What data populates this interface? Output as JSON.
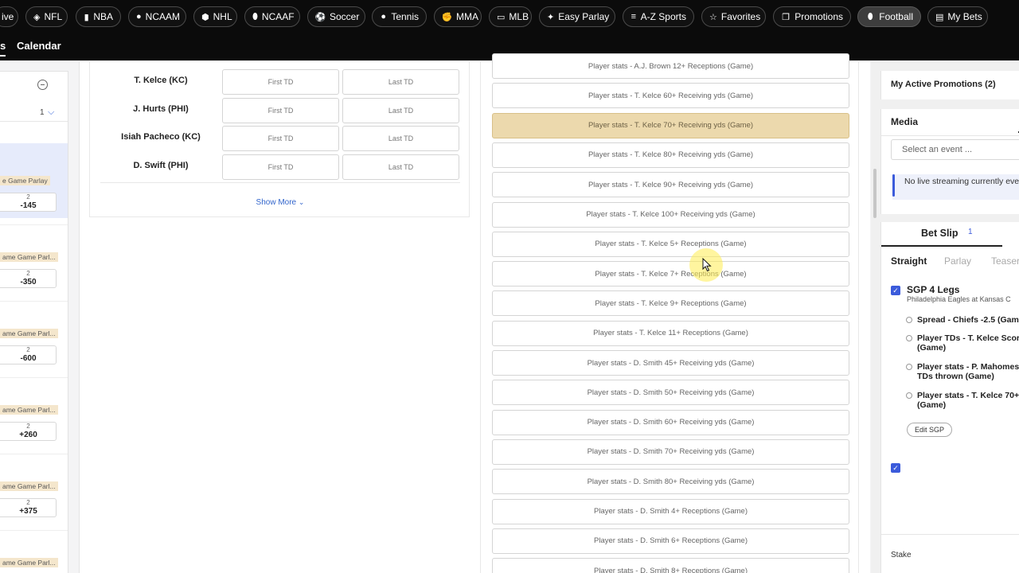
{
  "nav": {
    "pills": [
      {
        "label": "ive",
        "icon": "",
        "active": false
      },
      {
        "label": "NFL",
        "icon": "nfl-icon",
        "active": false
      },
      {
        "label": "NBA",
        "icon": "nba-icon",
        "active": false
      },
      {
        "label": "NCAAM",
        "icon": "basketball-icon",
        "active": false
      },
      {
        "label": "NHL",
        "icon": "nhl-icon",
        "active": false
      },
      {
        "label": "NCAAF",
        "icon": "football-icon",
        "active": false
      },
      {
        "label": "Soccer",
        "icon": "soccer-ball-icon",
        "active": false
      },
      {
        "label": "Tennis",
        "icon": "tennis-ball-icon",
        "active": false
      },
      {
        "label": "MMA",
        "icon": "glove-icon",
        "active": false
      },
      {
        "label": "MLB",
        "icon": "mlb-icon",
        "active": false
      },
      {
        "label": "Easy Parlay",
        "icon": "parlay-icon",
        "active": false
      },
      {
        "label": "A-Z Sports",
        "icon": "menu-icon",
        "active": false
      },
      {
        "label": "Favorites",
        "icon": "star-circle-icon",
        "active": false
      },
      {
        "label": "Promotions",
        "icon": "gift-icon",
        "active": false
      },
      {
        "label": "Football",
        "icon": "football-icon",
        "active": true
      },
      {
        "label": "My Bets",
        "icon": "ticket-icon",
        "active": false
      }
    ],
    "subnav": {
      "partial": "s",
      "calendar": "Calendar"
    }
  },
  "left": {
    "count": "1",
    "entries": [
      {
        "tag": "e Game Parlay",
        "top_label": "2",
        "odds": "-145"
      },
      {
        "tag": "ame Game Parl...",
        "top_label": "2",
        "odds": "-350"
      },
      {
        "tag": "ame Game Parl...",
        "top_label": "2",
        "odds": "-600"
      },
      {
        "tag": "ame Game Parl...",
        "top_label": "2",
        "odds": "+260"
      },
      {
        "tag": "ame Game Parl...",
        "top_label": "2",
        "odds": "+375"
      },
      {
        "tag": "ame Game Parl...",
        "top_label": "",
        "odds": ""
      }
    ]
  },
  "td": {
    "rows": [
      {
        "player": "T. Kelce (KC)",
        "first": "First TD",
        "last": "Last TD"
      },
      {
        "player": "J. Hurts (PHI)",
        "first": "First TD",
        "last": "Last TD"
      },
      {
        "player": "Isiah Pacheco (KC)",
        "first": "First TD",
        "last": "Last TD"
      },
      {
        "player": "D. Swift (PHI)",
        "first": "First TD",
        "last": "Last TD"
      }
    ],
    "show_more": "Show More"
  },
  "player_stats": [
    {
      "label": "Player stats - A.J. Brown 12+ Receptions (Game)",
      "selected": false
    },
    {
      "label": "Player stats - T. Kelce 60+ Receiving yds (Game)",
      "selected": false
    },
    {
      "label": "Player stats - T. Kelce 70+ Receiving yds (Game)",
      "selected": true
    },
    {
      "label": "Player stats - T. Kelce 80+ Receiving yds (Game)",
      "selected": false
    },
    {
      "label": "Player stats - T. Kelce 90+ Receiving yds (Game)",
      "selected": false
    },
    {
      "label": "Player stats - T. Kelce 100+ Receiving yds (Game)",
      "selected": false
    },
    {
      "label": "Player stats - T. Kelce 5+ Receptions (Game)",
      "selected": false
    },
    {
      "label": "Player stats - T. Kelce 7+ Receptions (Game)",
      "selected": false
    },
    {
      "label": "Player stats - T. Kelce 9+ Receptions (Game)",
      "selected": false
    },
    {
      "label": "Player stats - T. Kelce 11+ Receptions (Game)",
      "selected": false
    },
    {
      "label": "Player stats - D. Smith 45+ Receiving yds (Game)",
      "selected": false
    },
    {
      "label": "Player stats - D. Smith 50+ Receiving yds (Game)",
      "selected": false
    },
    {
      "label": "Player stats - D. Smith 60+ Receiving yds (Game)",
      "selected": false
    },
    {
      "label": "Player stats - D. Smith 70+ Receiving yds (Game)",
      "selected": false
    },
    {
      "label": "Player stats - D. Smith 80+ Receiving yds (Game)",
      "selected": false
    },
    {
      "label": "Player stats - D. Smith 4+ Receptions (Game)",
      "selected": false
    },
    {
      "label": "Player stats - D. Smith 6+ Receptions (Game)",
      "selected": false
    },
    {
      "label": "Player stats - D. Smith 8+ Receptions (Game)",
      "selected": false
    }
  ],
  "sidebar": {
    "promotions": "My Active Promotions (2)",
    "media": {
      "title": "Media",
      "select_placeholder": "Select an event ...",
      "info": "No live streaming currently event."
    },
    "betslip": {
      "title": "Bet Slip",
      "count": "1",
      "tabs": [
        "Straight",
        "Parlay",
        "Teaser"
      ],
      "sgp_title": "SGP 4 Legs",
      "sgp_sub": "Philadelphia Eagles at Kansas C",
      "legs": [
        "Spread - Chiefs -2.5 (Gam",
        "Player TDs - T. Kelce Scor (Game)",
        "Player stats - P. Mahomes TDs thrown (Game)",
        "Player stats - T. Kelce 70+ (Game)"
      ],
      "edit_label": "Edit SGP",
      "stake_label": "Stake"
    }
  },
  "colors": {
    "accent": "#3b5bdb",
    "selected_bg": "#ecd9ad",
    "nav_bg": "#0b0b0b"
  }
}
